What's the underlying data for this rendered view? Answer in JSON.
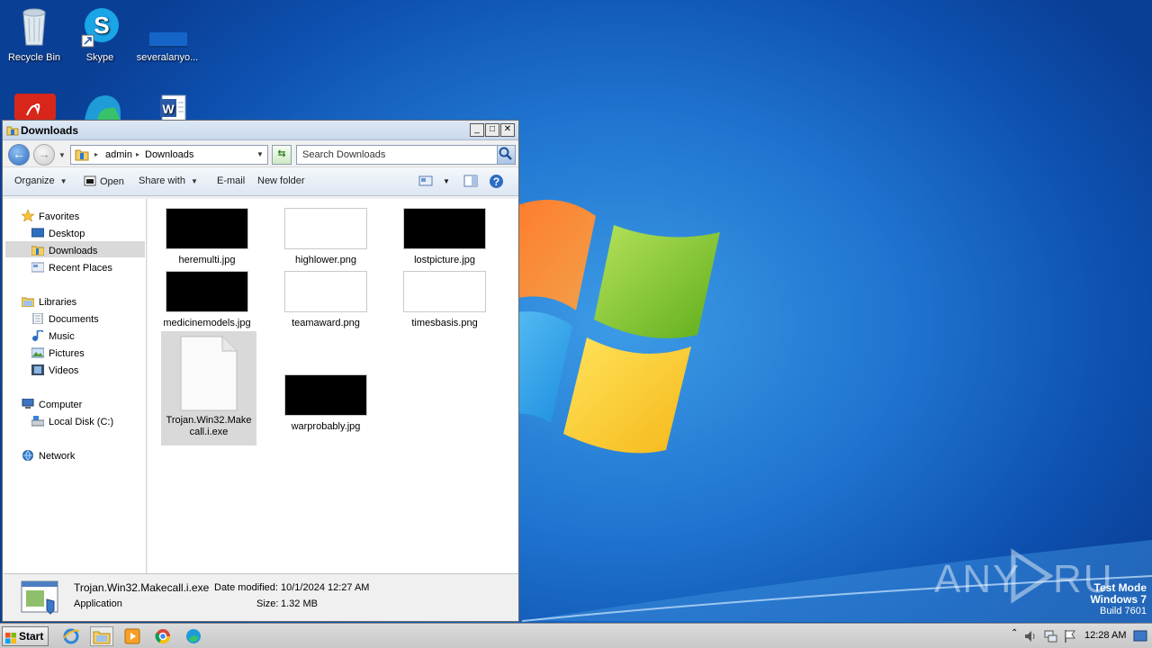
{
  "desktop": {
    "icons": [
      {
        "label": "Recycle Bin",
        "icon": "recycle-bin-icon"
      },
      {
        "label": "Skype",
        "icon": "skype-icon"
      },
      {
        "label": "severalanyo...",
        "icon": "file-icon"
      },
      {
        "label": "",
        "icon": "acrobat-icon"
      },
      {
        "label": "",
        "icon": "edge-icon"
      },
      {
        "label": "",
        "icon": "word-document-icon"
      }
    ],
    "watermark": {
      "logo_text": "ANY RUN",
      "line1": "Test Mode",
      "line2": "Windows 7",
      "line3": "Build 7601"
    }
  },
  "window": {
    "title": "Downloads",
    "buttons": {
      "minimize": "_",
      "maximize": "□",
      "close": "✕"
    },
    "address": {
      "crumbs": [
        "admin",
        "Downloads"
      ]
    },
    "search": {
      "placeholder": "Search Downloads"
    },
    "toolbar": {
      "organize": "Organize",
      "open": "Open",
      "share_with": "Share with",
      "email": "E-mail",
      "new_folder": "New folder"
    },
    "nav": {
      "favorites": "Favorites",
      "desktop": "Desktop",
      "downloads": "Downloads",
      "recent_places": "Recent Places",
      "libraries": "Libraries",
      "documents": "Documents",
      "music": "Music",
      "pictures": "Pictures",
      "videos": "Videos",
      "computer": "Computer",
      "local_disk": "Local Disk (C:)",
      "network": "Network"
    },
    "files": [
      {
        "name": "heremulti.jpg",
        "thumb": "dark"
      },
      {
        "name": "highlower.png",
        "thumb": "light"
      },
      {
        "name": "lostpicture.jpg",
        "thumb": "dark"
      },
      {
        "name": "medicinemodels.jpg",
        "thumb": "dark"
      },
      {
        "name": "teamaward.png",
        "thumb": "light"
      },
      {
        "name": "timesbasis.png",
        "thumb": "light"
      },
      {
        "name": "Trojan.Win32.Makecall.i.exe",
        "thumb": "exe",
        "name_line1": "Trojan.Win32.Make",
        "name_line2": "call.i.exe",
        "selected": true
      },
      {
        "name": "warprobably.jpg",
        "thumb": "dark"
      }
    ],
    "details": {
      "filename": "Trojan.Win32.Makecall.i.exe",
      "type": "Application",
      "date_label": "Date modified:",
      "date_value": "10/1/2024 12:27 AM",
      "size_label": "Size:",
      "size_value": "1.32 MB"
    }
  },
  "taskbar": {
    "start": "Start",
    "apps": [
      "internet-explorer-icon",
      "file-explorer-icon",
      "media-player-icon",
      "chrome-icon",
      "edge-icon"
    ],
    "clock": "12:28 AM"
  }
}
